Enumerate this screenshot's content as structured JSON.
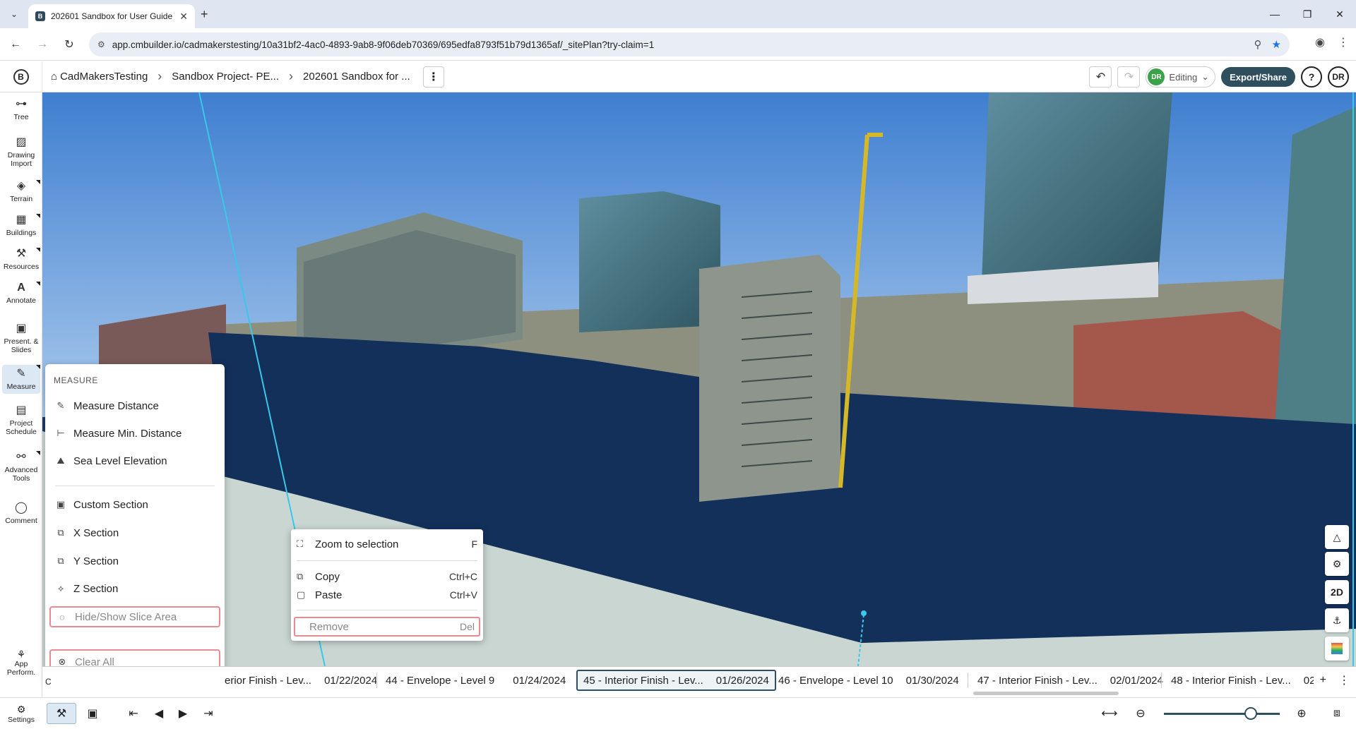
{
  "browser": {
    "tab_title": "202601 Sandbox for User Guide",
    "url_site": "⚙",
    "url": "app.cmbuilder.io/cadmakerstesting/10a31bf2-4ac0-4893-9ab8-9f06deb70369/695edfa8793f51b79d1365af/_sitePlan?try-claim=1"
  },
  "header": {
    "logo": "B",
    "breadcrumbs": [
      "CadMakersTesting",
      "Sandbox Project- PE...",
      "202601 Sandbox for ..."
    ],
    "user_initials": "DR",
    "mode_label": "Editing",
    "export_label": "Export/Share",
    "help_label": "?",
    "avatar_label": "DR"
  },
  "left_toolbar": {
    "items": [
      {
        "label": "Tree"
      },
      {
        "label": "Drawing Import"
      },
      {
        "label": "Terrain"
      },
      {
        "label": "Buildings"
      },
      {
        "label": "Resources"
      },
      {
        "label": "Annotate"
      },
      {
        "label": "Present. & Slides"
      },
      {
        "label": "Measure"
      },
      {
        "label": "Project Schedule"
      },
      {
        "label": "Advanced Tools"
      },
      {
        "label": "Comment"
      },
      {
        "label": "App Perform."
      },
      {
        "label": "Settings"
      }
    ]
  },
  "measure_menu": {
    "header": "MEASURE",
    "items": [
      {
        "label": "Measure Distance"
      },
      {
        "label": "Measure Min. Distance"
      },
      {
        "label": "Sea Level Elevation"
      },
      {
        "label": "Custom Section"
      },
      {
        "label": "X Section"
      },
      {
        "label": "Y Section"
      },
      {
        "label": "Z Section"
      },
      {
        "label": "Hide/Show Slice Area"
      },
      {
        "label": "Clear All"
      }
    ]
  },
  "context_menu": {
    "items": [
      {
        "label": "Zoom to selection",
        "shortcut": "F"
      },
      {
        "label": "Copy",
        "shortcut": "Ctrl+C"
      },
      {
        "label": "Paste",
        "shortcut": "Ctrl+V"
      },
      {
        "label": "Remove",
        "shortcut": "Del"
      }
    ]
  },
  "viewport_controls": {
    "view_2d_label": "2D"
  },
  "timeline": {
    "items": [
      {
        "name": "erior Finish - Lev...",
        "date": "01/22/2024"
      },
      {
        "name": "44 - Envelope - Level 9",
        "date": "01/24/2024"
      },
      {
        "name": "45 - Interior Finish - Lev...",
        "date": "01/26/2024"
      },
      {
        "name": "46 - Envelope - Level 10",
        "date": "01/30/2024"
      },
      {
        "name": "47 - Interior Finish - Lev...",
        "date": "02/01/2024"
      },
      {
        "name": "48 - Interior Finish - Lev...",
        "date": "02"
      }
    ]
  },
  "bottom_left_label": "C",
  "colors": {
    "accent": "#2f4f5f",
    "highlight_border": "#e98b94",
    "sky": "#6fa3dd",
    "slice_blue": "#14305a"
  }
}
